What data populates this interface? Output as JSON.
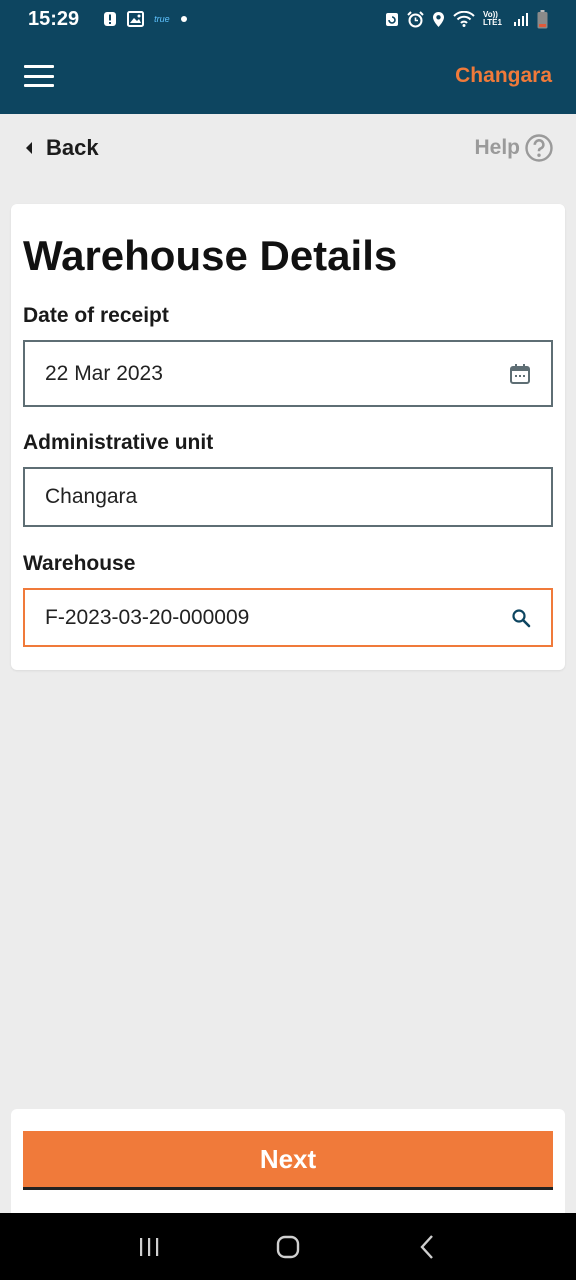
{
  "status_bar": {
    "time": "15:29",
    "carrier": "true",
    "network": "Vo)) LTE1",
    "icons": [
      "alert-icon",
      "image-icon",
      "dot-icon",
      "backup-icon",
      "alarm-icon",
      "location-icon",
      "wifi-icon",
      "signal-icon",
      "battery-icon"
    ]
  },
  "app_bar": {
    "title": "Changara",
    "menu_icon": "hamburger-menu-icon"
  },
  "nav": {
    "back_label": "Back",
    "help_label": "Help"
  },
  "form": {
    "title": "Warehouse Details",
    "fields": [
      {
        "label": "Date of receipt",
        "value": "22 Mar 2023",
        "icon": "calendar-icon"
      },
      {
        "label": "Administrative unit",
        "value": "Changara"
      },
      {
        "label": "Warehouse",
        "value": "F-2023-03-20-000009",
        "icon": "search-icon"
      }
    ]
  },
  "footer": {
    "next_label": "Next"
  },
  "colors": {
    "header": "#0d4560",
    "accent": "#f07a3a",
    "background": "#ececec"
  }
}
